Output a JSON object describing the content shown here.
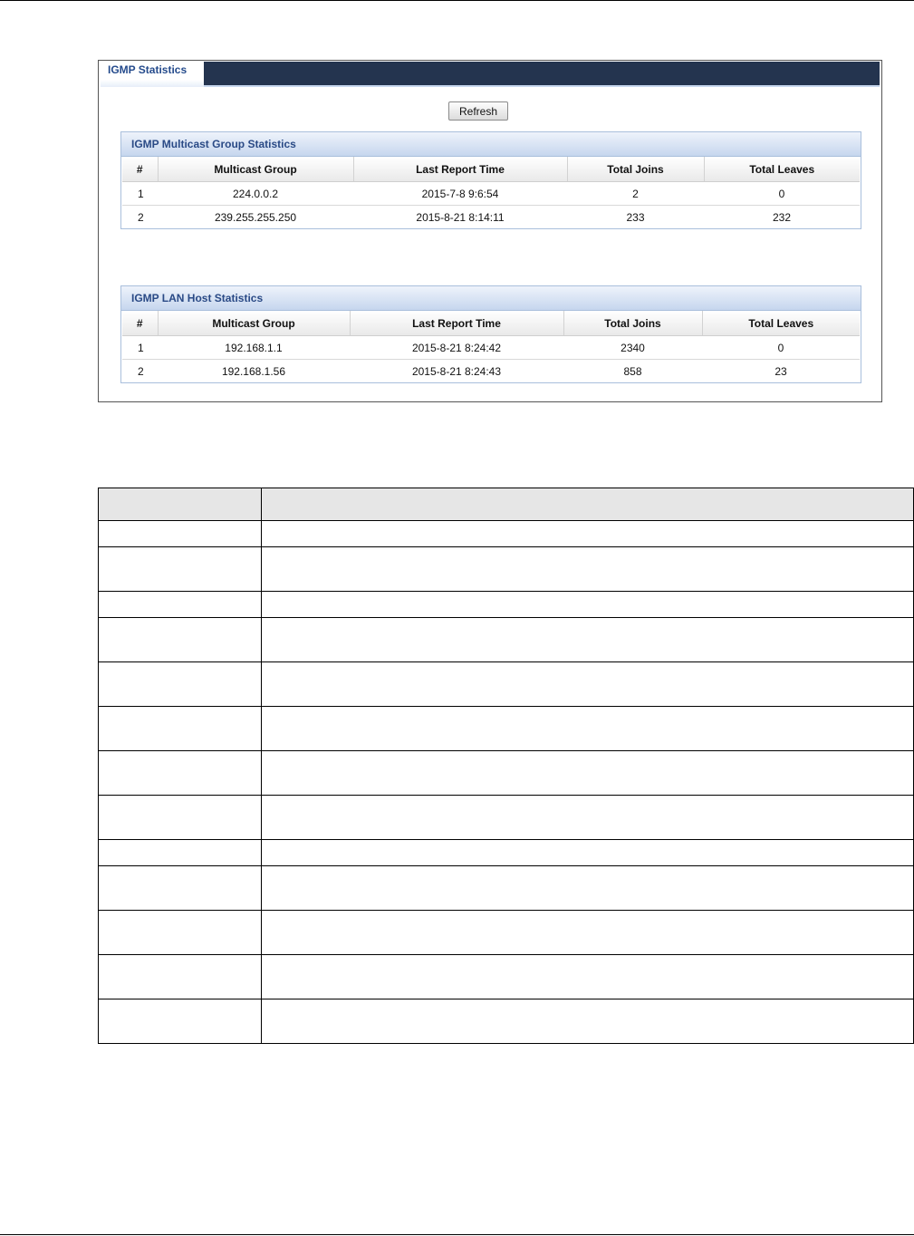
{
  "window": {
    "tab_label": "IGMP Statistics",
    "refresh_label": "Refresh"
  },
  "multicast_group_stats": {
    "title": "IGMP Multicast Group Statistics",
    "columns": [
      "#",
      "Multicast Group",
      "Last Report Time",
      "Total Joins",
      "Total Leaves"
    ],
    "rows": [
      [
        "1",
        "224.0.0.2",
        "2015-7-8 9:6:54",
        "2",
        "0"
      ],
      [
        "2",
        "239.255.255.250",
        "2015-8-21 8:14:11",
        "233",
        "232"
      ]
    ]
  },
  "lan_host_stats": {
    "title": "IGMP LAN Host Statistics",
    "columns": [
      "#",
      "Multicast Group",
      "Last Report Time",
      "Total Joins",
      "Total Leaves"
    ],
    "rows": [
      [
        "1",
        "192.168.1.1",
        "2015-8-21 8:24:42",
        "2340",
        "0"
      ],
      [
        "2",
        "192.168.1.56",
        "2015-8-21 8:24:43",
        "858",
        "23"
      ]
    ]
  }
}
